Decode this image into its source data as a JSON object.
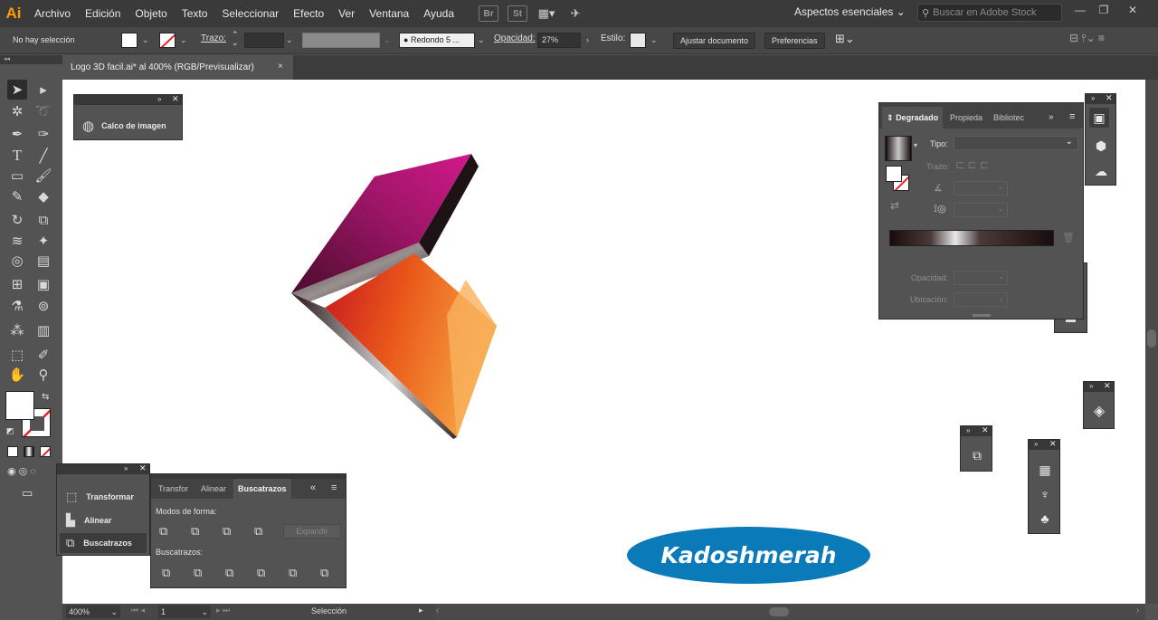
{
  "app": {
    "logo": "Ai"
  },
  "menu": [
    "Archivo",
    "Edición",
    "Objeto",
    "Texto",
    "Seleccionar",
    "Efecto",
    "Ver",
    "Ventana",
    "Ayuda"
  ],
  "menubar_icons": {
    "br": "Br",
    "st": "St"
  },
  "workspace": {
    "label": "Aspectos esenciales"
  },
  "search": {
    "placeholder": "Buscar en Adobe Stock"
  },
  "control": {
    "selection": "No hay selección",
    "stroke_label": "Trazo:",
    "brush": "Redondo 5 ...",
    "opacity_label": "Opacidad:",
    "opacity_value": "27%",
    "style_label": "Estilo:",
    "fit_button": "Ajustar documento",
    "prefs_button": "Preferencias"
  },
  "document": {
    "tab_title": "Logo 3D facil.ai* al 400% (RGB/Previsualizar)",
    "close": "×"
  },
  "status": {
    "zoom": "400%",
    "artboard": "1",
    "tool": "Selección"
  },
  "image_trace_panel": {
    "label": "Calco de imagen"
  },
  "left_panel": {
    "items": [
      "Transformar",
      "Alinear",
      "Buscatrazos"
    ]
  },
  "pathfinder_panel": {
    "tabs": [
      "Transfor",
      "Alinear",
      "Buscatrazos"
    ],
    "shape_modes_label": "Modos de forma:",
    "expand_button": "Expandir",
    "pathfinders_label": "Buscatrazos:"
  },
  "gradient_panel": {
    "tabs": [
      "Degradado",
      "Propieda",
      "Bibliotec"
    ],
    "type_label": "Tipo:",
    "stroke_label": "Trazo:",
    "opacity_label": "Opacidad:",
    "location_label": "Ubicación:"
  },
  "watermark": {
    "text": "Kadoshmerah"
  },
  "colors": {
    "accent": "#ff9a00",
    "watermark_bg": "#0a7ab8",
    "magenta_face": "#c3157e",
    "orange_face": "#f07a1a"
  }
}
